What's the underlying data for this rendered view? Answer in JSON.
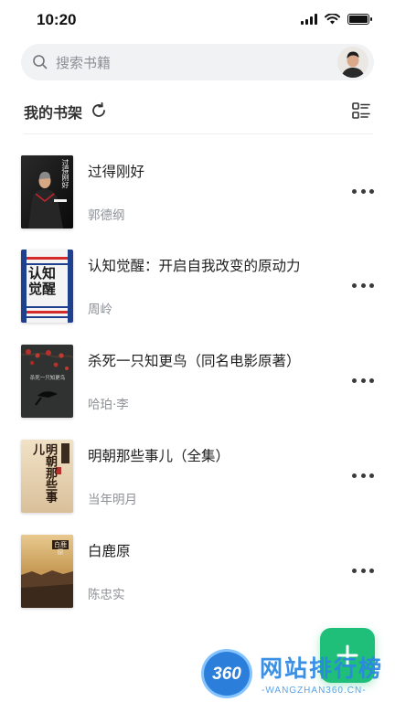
{
  "status_bar": {
    "time": "10:20"
  },
  "search": {
    "placeholder": "搜索书籍"
  },
  "shelf": {
    "title": "我的书架"
  },
  "books": [
    {
      "title": "过得刚好",
      "author": "郭德纲",
      "cover_text": "过得刚好"
    },
    {
      "title": "认知觉醒：开启自我改变的原动力",
      "author": "周岭",
      "cover_text": "认知觉醒"
    },
    {
      "title": "杀死一只知更鸟（同名电影原著）",
      "author": "哈珀·李",
      "cover_text": "杀死一只知更鸟"
    },
    {
      "title": "明朝那些事儿（全集）",
      "author": "当年明月",
      "cover_text": "明朝那些事儿"
    },
    {
      "title": "白鹿原",
      "author": "陈忠实",
      "cover_text": "白鹿原"
    }
  ],
  "icons": {
    "search": "search-icon",
    "refresh": "refresh-icon",
    "list_view": "list-view-icon",
    "more": "more-icon",
    "add": "plus-icon"
  },
  "colors": {
    "accent": "#1fbf7a",
    "watermark_blue": "#2b87e4"
  },
  "watermark": {
    "badge": "360",
    "name": "网站排行榜",
    "url": "-WANGZHAN360.CN-"
  }
}
